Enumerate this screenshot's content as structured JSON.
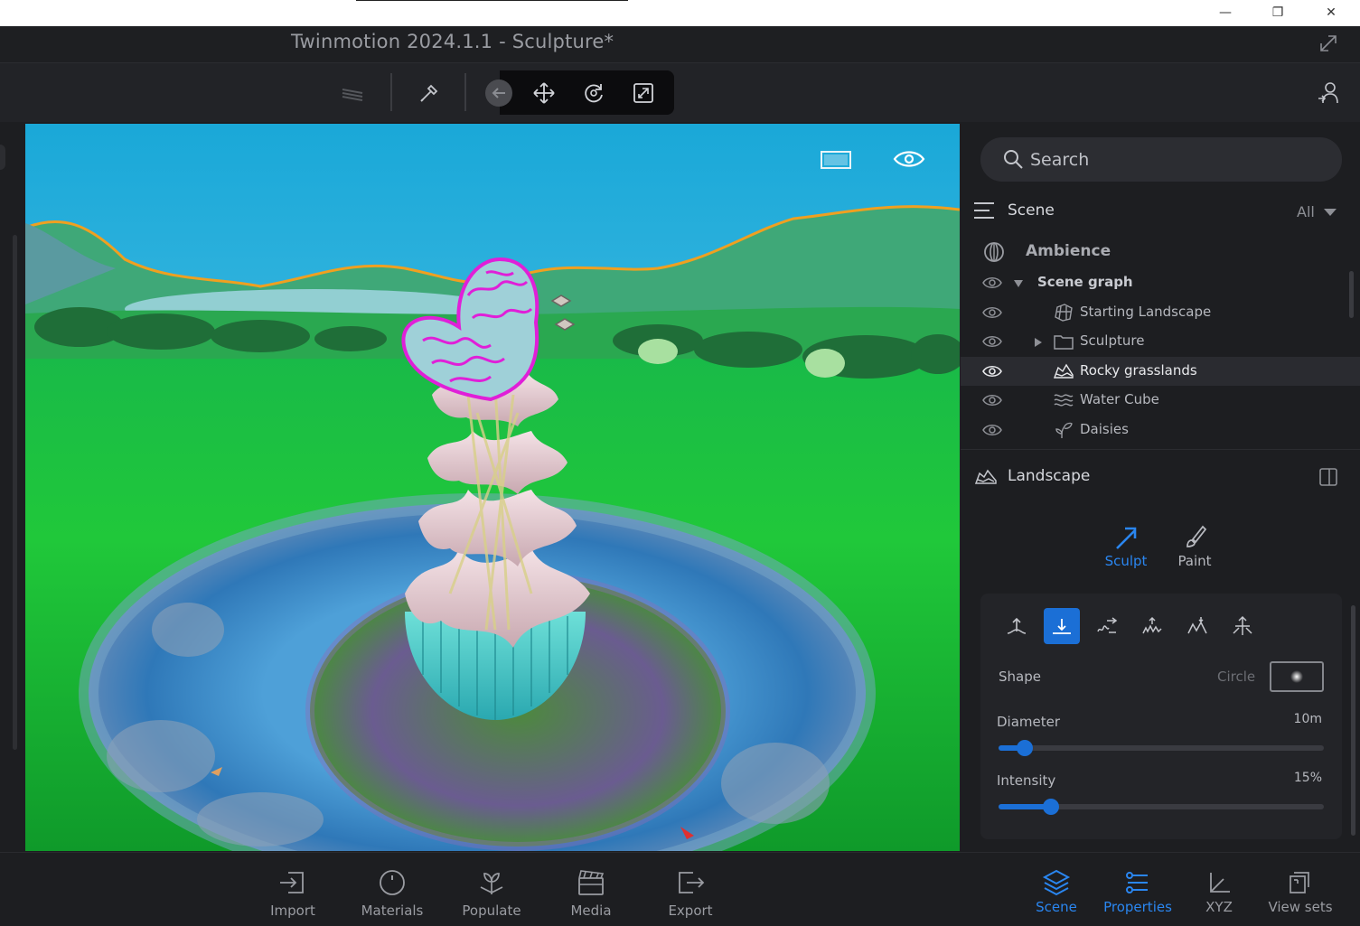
{
  "window": {
    "minimize_glyph": "—",
    "restore_glyph": "❐",
    "close_glyph": "✕"
  },
  "app": {
    "title": "Twinmotion 2024.1.1 - Sculpture*"
  },
  "search": {
    "placeholder": "Search"
  },
  "scene": {
    "title": "Scene",
    "filter": "All",
    "ambience": "Ambience",
    "graph_label": "Scene graph",
    "items": [
      {
        "label": "Starting Landscape",
        "icon": "landscape-grid-icon"
      },
      {
        "label": "Sculpture",
        "icon": "folder-icon"
      },
      {
        "label": "Rocky grasslands",
        "icon": "terrain-icon",
        "selected": true
      },
      {
        "label": "Water Cube",
        "icon": "water-icon"
      },
      {
        "label": "Daisies",
        "icon": "plant-icon"
      }
    ]
  },
  "landscape": {
    "title": "Landscape",
    "modes": [
      {
        "label": "Sculpt",
        "active": true
      },
      {
        "label": "Paint",
        "active": false
      }
    ],
    "shape_label": "Shape",
    "shape_value": "Circle",
    "diameter_label": "Diameter",
    "diameter_value": "10m",
    "diameter_fraction": 0.08,
    "intensity_label": "Intensity",
    "intensity_value": "15%",
    "intensity_fraction": 0.16
  },
  "bottom": {
    "left": [
      {
        "label": "Import"
      },
      {
        "label": "Materials"
      },
      {
        "label": "Populate"
      },
      {
        "label": "Media"
      },
      {
        "label": "Export"
      }
    ],
    "right": [
      {
        "label": "Scene",
        "active": true
      },
      {
        "label": "Properties",
        "active": true
      },
      {
        "label": "XYZ",
        "active": false
      },
      {
        "label": "View sets",
        "active": false
      }
    ]
  },
  "colors": {
    "accent": "#1b6fd6",
    "accent_text": "#2a86f0",
    "highlight_pink": "#e01fd8",
    "outline_orange": "#f0a020"
  }
}
